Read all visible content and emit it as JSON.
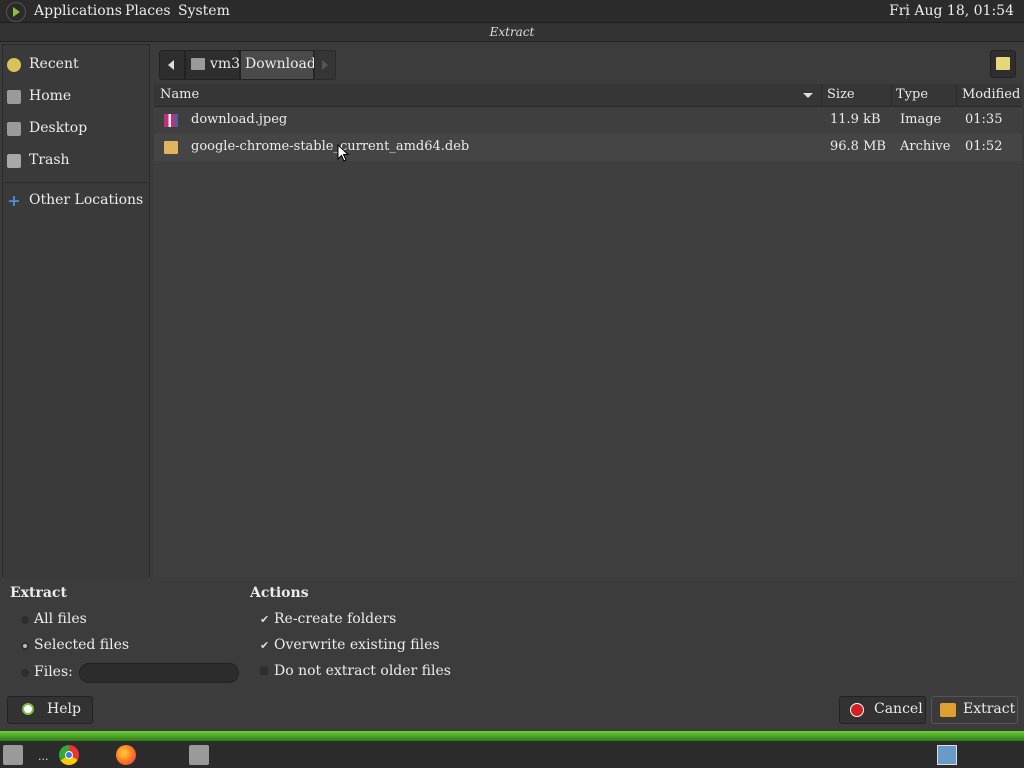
{
  "topbar": {
    "menus": [
      "Applications",
      "Places",
      "System"
    ],
    "clock": "Fri Aug 18, 01:54"
  },
  "window": {
    "title": "Extract"
  },
  "sidebar": {
    "items": [
      {
        "label": "Recent",
        "icon": "recent-icon"
      },
      {
        "label": "Home",
        "icon": "home-folder-icon"
      },
      {
        "label": "Desktop",
        "icon": "desktop-folder-icon"
      },
      {
        "label": "Trash",
        "icon": "trash-icon"
      }
    ],
    "other_locations": "Other Locations"
  },
  "pathbar": {
    "crumbs": [
      "vm3",
      "Downloads"
    ]
  },
  "filelist": {
    "columns": [
      "Name",
      "Size",
      "Type",
      "Modified"
    ],
    "rows": [
      {
        "name": "download.jpeg",
        "size": "11.9 kB",
        "type": "Image",
        "modified": "01:35",
        "icon": "image-file-icon"
      },
      {
        "name": "google-chrome-stable_current_amd64.deb",
        "size": "96.8 MB",
        "type": "Archive",
        "modified": "01:52",
        "icon": "archive-file-icon"
      }
    ]
  },
  "options": {
    "extract_heading": "Extract",
    "all_files": "All files",
    "selected_files": "Selected files",
    "files_label": "Files:",
    "files_value": "",
    "actions_heading": "Actions",
    "recreate_folders": "Re-create folders",
    "overwrite_existing": "Overwrite existing files",
    "do_not_extract_older": "Do not extract older files",
    "selected_mode": "Selected files",
    "recreate_checked": true,
    "overwrite_checked": true,
    "older_checked": false
  },
  "buttons": {
    "help": "Help",
    "cancel": "Cancel",
    "extract": "Extract"
  },
  "taskbar": {
    "dots": "...",
    "icons": [
      "files-icon",
      "chrome-icon",
      "firefox-icon",
      "file-manager-icon",
      "network-icon"
    ]
  }
}
